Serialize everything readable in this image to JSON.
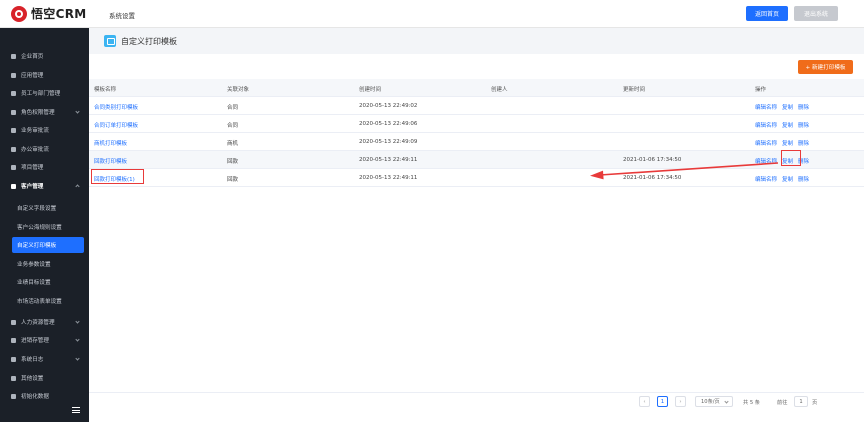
{
  "app": {
    "logo_text": "悟空CRM",
    "section_title": "系统设置",
    "btn_home": "返回首页",
    "btn_exit": "退出系统"
  },
  "sidebar": {
    "items": [
      {
        "label": "企业首页",
        "icon": "home-icon"
      },
      {
        "label": "应用管理",
        "icon": "apps-icon"
      },
      {
        "label": "员工与部门管理",
        "icon": "users-icon"
      },
      {
        "label": "角色权限管理",
        "icon": "role-icon"
      },
      {
        "label": "业务审批流",
        "icon": "approval-icon"
      },
      {
        "label": "办公审批流",
        "icon": "office-approval-icon"
      },
      {
        "label": "项目管理",
        "icon": "project-icon"
      },
      {
        "label": "客户管理",
        "icon": "customer-icon"
      }
    ],
    "sub_items": [
      {
        "label": "自定义字段设置"
      },
      {
        "label": "客户公海规则设置"
      },
      {
        "label": "自定义打印模板"
      },
      {
        "label": "业务参数设置"
      },
      {
        "label": "业绩目标设置"
      },
      {
        "label": "市场活动表单设置"
      }
    ],
    "bottom_items": [
      {
        "label": "人力资源管理",
        "icon": "hr-icon"
      },
      {
        "label": "进销存管理",
        "icon": "inventory-icon"
      },
      {
        "label": "系统日志",
        "icon": "log-icon"
      },
      {
        "label": "其他设置",
        "icon": "settings-icon"
      },
      {
        "label": "初始化数据",
        "icon": "init-icon"
      }
    ]
  },
  "page": {
    "title": "自定义打印模板",
    "btn_new": "+ 新建打印模板"
  },
  "table": {
    "headers": [
      "模板名称",
      "关联对象",
      "创建时间",
      "创建人",
      "更新时间",
      "操作"
    ],
    "rows": [
      {
        "name": "合同类别打印模板",
        "obj": "合同",
        "created": "2020-05-13 22:49:02",
        "creator": "",
        "updated": ""
      },
      {
        "name": "合同订单打印模板",
        "obj": "合同",
        "created": "2020-05-13 22:49:06",
        "creator": "",
        "updated": ""
      },
      {
        "name": "商机打印模板",
        "obj": "商机",
        "created": "2020-05-13 22:49:09",
        "creator": "",
        "updated": ""
      },
      {
        "name": "回款打印模板",
        "obj": "回款",
        "created": "2020-05-13 22:49:11",
        "creator": "",
        "updated": "2021-01-06 17:34:50"
      },
      {
        "name": "回款打印模板(1)",
        "obj": "回款",
        "created": "2020-05-13 22:49:11",
        "creator": "",
        "updated": "2021-01-06 17:34:50"
      }
    ],
    "ops": [
      "编辑名称",
      "复制",
      "删除"
    ]
  },
  "pager": {
    "prev": "‹",
    "current": "1",
    "next": "›",
    "page_size": "10条/页",
    "total": "共 5 条",
    "goto_label": "前往",
    "goto_value": "1",
    "page_unit": "页"
  },
  "colors": {
    "primary": "#1e6fff",
    "accent_orange": "#f06c1a",
    "sidebar_bg": "#1b2028",
    "highlight_red": "#e83a3a"
  }
}
